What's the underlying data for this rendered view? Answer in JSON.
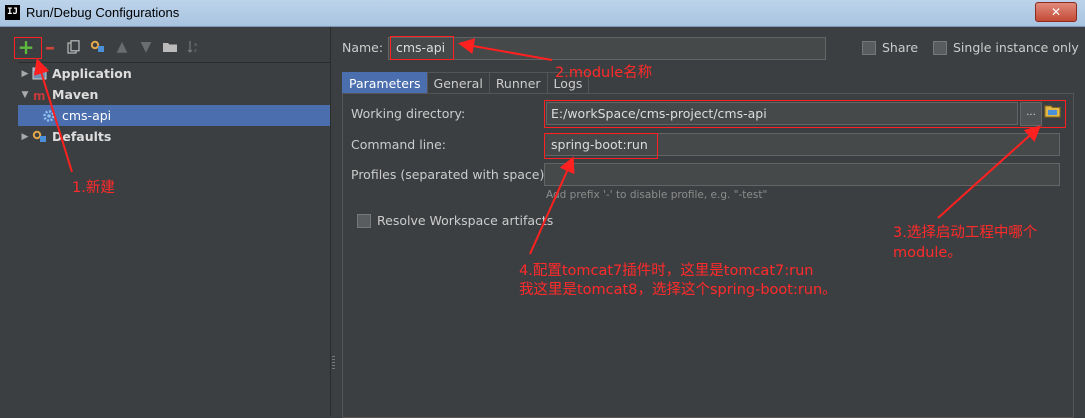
{
  "window": {
    "title": "Run/Debug Configurations",
    "app_icon": "IJ",
    "close_label": "✕"
  },
  "toolbar": {
    "buttons": [
      "plus-icon",
      "minus-icon",
      "copy-icon",
      "wrench-icon",
      "arrow-up-icon",
      "arrow-down-icon",
      "folder-icon",
      "sort-icon"
    ]
  },
  "tree": {
    "items": [
      {
        "label": "Application",
        "expanded": false
      },
      {
        "label": "Maven",
        "expanded": true
      },
      {
        "label": "cms-api",
        "selected": true
      },
      {
        "label": "Defaults",
        "expanded": false
      }
    ]
  },
  "form": {
    "name_label": "Name:",
    "name_value": "cms-api",
    "share_label": "Share",
    "single_instance_label": "Single instance only",
    "tabs": [
      "Parameters",
      "General",
      "Runner",
      "Logs"
    ],
    "working_dir_label": "Working directory:",
    "working_dir_value": "E:/workSpace/cms-project/cms-api",
    "browse_label": "...",
    "command_line_label": "Command line:",
    "command_line_value": "spring-boot:run",
    "profiles_label": "Profiles (separated with space):",
    "profiles_hint": "Add prefix '-' to disable profile, e.g. \"-test\"",
    "resolve_label": "Resolve Workspace artifacts"
  },
  "annotations": {
    "a1": "1.新建",
    "a2": "2.module名称",
    "a3_line1": "3.选择启动工程中哪个",
    "a3_line2": "module。",
    "a4_line1": "4.配置tomcat7插件时，这里是tomcat7:run",
    "a4_line2": "我这里是tomcat8，选择这个spring-boot:run。"
  },
  "colors": {
    "annotation": "#ff2a2a",
    "selection": "#4b6eaf",
    "add_icon": "#5eba3c",
    "remove_icon": "#d04437"
  }
}
